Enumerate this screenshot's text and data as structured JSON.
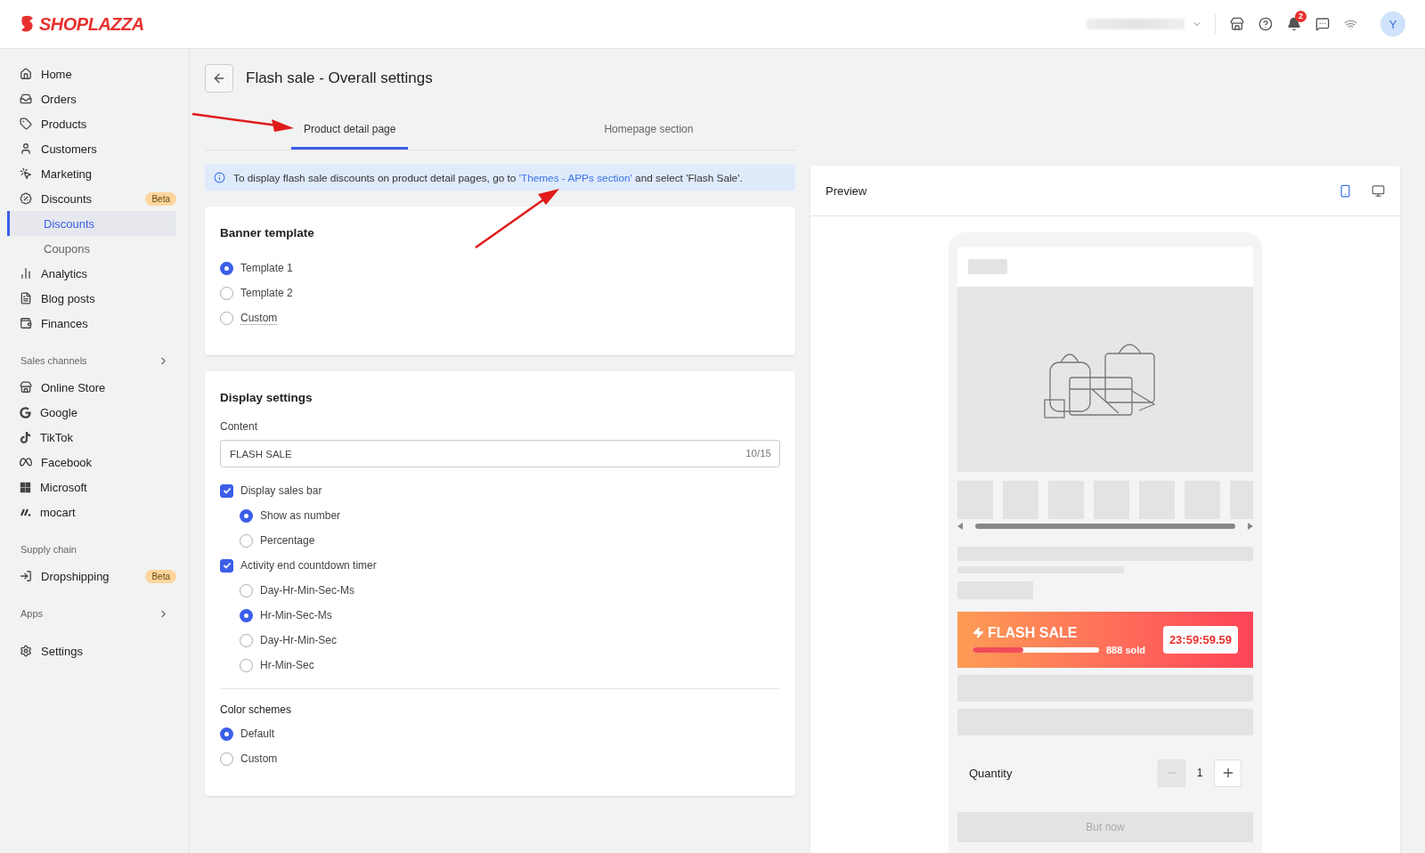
{
  "header": {
    "logo": "SHOPLAZZA",
    "notification_count": "2",
    "avatar": "Y"
  },
  "sidebar": {
    "sections": [
      {
        "items": [
          {
            "label": "Home",
            "selected": false
          },
          {
            "label": "Orders",
            "selected": false
          },
          {
            "label": "Products",
            "selected": false
          },
          {
            "label": "Customers",
            "selected": false
          },
          {
            "label": "Marketing",
            "selected": false
          },
          {
            "label": "Discounts",
            "badge": "Beta",
            "selected": false,
            "expanded": true,
            "children": [
              {
                "label": "Discounts",
                "selected": true
              },
              {
                "label": "Coupons",
                "selected": false
              }
            ]
          },
          {
            "label": "Analytics",
            "selected": false
          },
          {
            "label": "Blog posts",
            "selected": false
          },
          {
            "label": "Finances",
            "selected": false
          }
        ]
      },
      {
        "heading": "Sales channels",
        "chevron": true,
        "items": [
          {
            "label": "Online Store",
            "selected": false
          },
          {
            "label": "Google",
            "selected": false
          },
          {
            "label": "TikTok",
            "selected": false
          },
          {
            "label": "Facebook",
            "selected": false
          },
          {
            "label": "Microsoft",
            "selected": false
          },
          {
            "label": "mocart",
            "selected": false
          }
        ]
      },
      {
        "heading": "Supply chain",
        "chevron": false,
        "items": [
          {
            "label": "Dropshipping",
            "badge": "Beta",
            "selected": false
          }
        ]
      },
      {
        "heading": "Apps",
        "chevron": true
      },
      {
        "items": [
          {
            "label": "Settings",
            "selected": false
          }
        ]
      }
    ]
  },
  "page": {
    "title": "Flash sale - Overall settings",
    "tabs": [
      {
        "label": "Product detail page",
        "selected": true
      },
      {
        "label": "Homepage section",
        "selected": false
      }
    ],
    "notice": {
      "text": "To display flash sale discounts on product detail pages, go to ",
      "link": "'Themes - APPs section'",
      "text_after": " and select 'Flash Sale'."
    },
    "banner_template": {
      "title": "Banner template",
      "options": [
        {
          "label": "Template 1",
          "selected": true,
          "underlined": false
        },
        {
          "label": "Template 2",
          "selected": false,
          "underlined": false
        },
        {
          "label": "Custom",
          "selected": false,
          "underlined": true
        }
      ]
    },
    "display_settings": {
      "title": "Display settings",
      "content_label": "Content",
      "content_value": "FLASH SALE",
      "content_counter": "10/15",
      "groups": [
        {
          "label": "Display sales bar",
          "checked": true,
          "options": [
            {
              "label": "Show as number",
              "selected": true
            },
            {
              "label": "Percentage",
              "selected": false
            }
          ]
        },
        {
          "label": "Activity end countdown timer",
          "checked": true,
          "options": [
            {
              "label": "Day-Hr-Min-Sec-Ms",
              "selected": false
            },
            {
              "label": "Hr-Min-Sec-Ms",
              "selected": true
            },
            {
              "label": "Day-Hr-Min-Sec",
              "selected": false
            },
            {
              "label": "Hr-Min-Sec",
              "selected": false
            }
          ]
        }
      ],
      "color_schemes": {
        "title": "Color schemes",
        "options": [
          {
            "label": "Default",
            "selected": true
          },
          {
            "label": "Custom",
            "selected": false
          }
        ]
      }
    }
  },
  "preview": {
    "title": "Preview",
    "devices": [
      {
        "kind": "mobile",
        "selected": true
      },
      {
        "kind": "desktop",
        "selected": false
      }
    ],
    "flash_banner": {
      "title": "FLASH SALE",
      "level": 0.4,
      "sold": "888 sold",
      "timer": "23:59:59.59"
    },
    "quantity": {
      "label": "Quantity",
      "value": "1"
    },
    "buy_button": "But now"
  }
}
